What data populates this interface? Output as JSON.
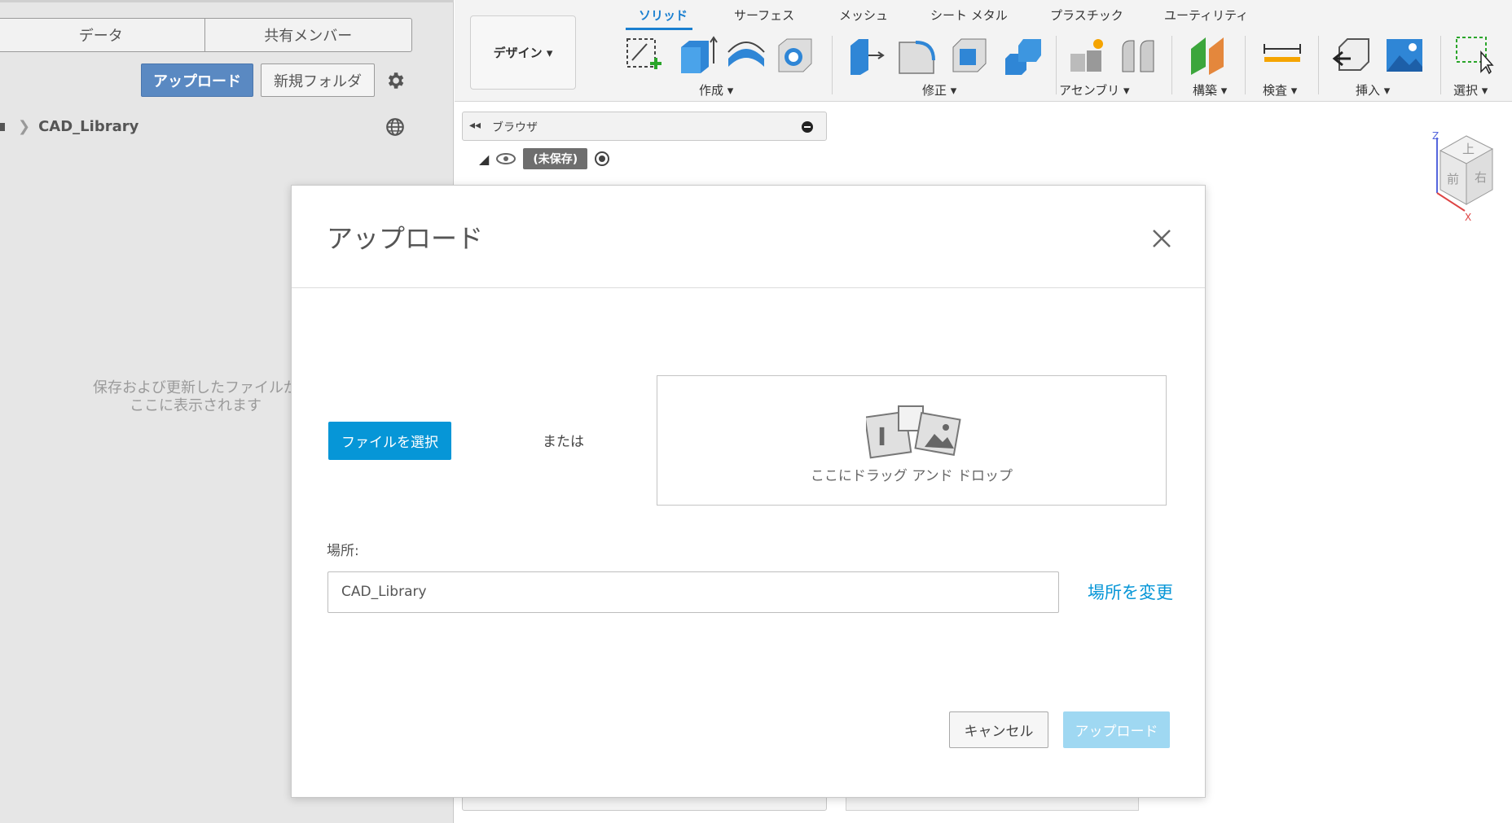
{
  "left_panel": {
    "tabs": [
      "データ",
      "共有メンバー"
    ],
    "upload_label": "アップロード",
    "new_folder_label": "新規フォルダ",
    "breadcrumb": "CAD_Library",
    "empty_note": "保存および更新したファイルがここに表示されます"
  },
  "toolbar": {
    "design_label": "デザイン ▾",
    "workspace_tabs": [
      "ソリッド",
      "サーフェス",
      "メッシュ",
      "シート メタル",
      "プラスチック",
      "ユーティリティ"
    ],
    "active_tab": "ソリッド",
    "groups": [
      "作成 ▾",
      "修正 ▾",
      "アセンブリ ▾",
      "構築 ▾",
      "検査 ▾",
      "挿入 ▾",
      "選択 ▾"
    ]
  },
  "browser": {
    "label": "ブラウザ",
    "document": "(未保存)"
  },
  "viewcube": {
    "faces": [
      "上",
      "前",
      "右"
    ],
    "axes": [
      "Z",
      "X"
    ]
  },
  "dialog": {
    "title": "アップロード",
    "select_file_label": "ファイルを選択",
    "or_label": "または",
    "drop_label": "ここにドラッグ アンド ドロップ",
    "location_label": "場所:",
    "location_value": "CAD_Library",
    "change_location_label": "場所を変更",
    "cancel_label": "キャンセル",
    "upload_label": "アップロード"
  },
  "colors": {
    "accent": "#0696d7",
    "upload_disabled": "#9fd8f2",
    "left_panel_upload": "#5a89c2"
  }
}
